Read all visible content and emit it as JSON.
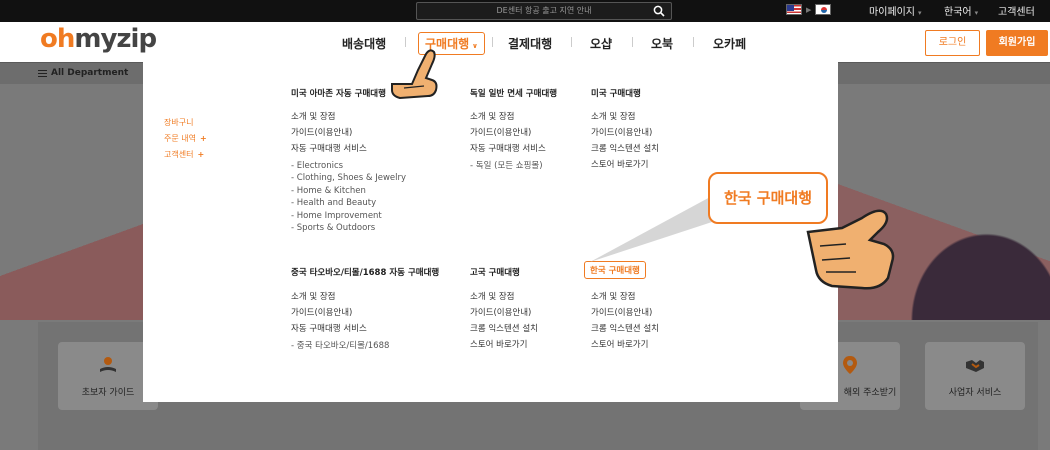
{
  "topbar": {
    "notice": "DE센터 항공 출고 지연 안내",
    "mypage": "마이페이지",
    "language": "한국어",
    "support": "고객센터"
  },
  "header": {
    "logo_oh": "oh",
    "logo_rest": "myzip",
    "nav": [
      "배송대행",
      "구매대행",
      "결제대행",
      "오샵",
      "오북",
      "오카페"
    ],
    "active_nav": "구매대행",
    "login": "로그인",
    "join": "회원가입"
  },
  "subbar": {
    "all_department": "All Department"
  },
  "dropdown": {
    "side": [
      "장바구니",
      "주문 내역",
      "고객센터"
    ],
    "amazon": {
      "title": "미국 아마존 자동 구매대행",
      "links": [
        "소개 및 장점",
        "가이드(이용안내)",
        "자동 구매대행 서비스"
      ],
      "categories": [
        "Electronics",
        "Clothing, Shoes & Jewelry",
        "Home & Kitchen",
        "Health and Beauty",
        "Home Improvement",
        "Sports & Outdoors"
      ]
    },
    "germany": {
      "title": "독일 일반 면세 구매대행",
      "links": [
        "소개 및 장점",
        "가이드(이용안내)",
        "자동 구매대행 서비스"
      ],
      "categories": [
        "독일 (모든 쇼핑몰)"
      ]
    },
    "usa": {
      "title": "미국 구매대행",
      "links": [
        "소개 및 장점",
        "가이드(이용안내)",
        "크롬 익스텐션 설치",
        "스토어 바로가기"
      ]
    },
    "china": {
      "title": "중국 타오바오/티몰/1688 자동 구매대행",
      "links": [
        "소개 및 장점",
        "가이드(이용안내)",
        "자동 구매대행 서비스"
      ],
      "categories": [
        "중국 타오바오/티몰/1688"
      ]
    },
    "other": {
      "title": "고국 구매대행",
      "links": [
        "소개 및 장점",
        "가이드(이용안내)",
        "크롬 익스텐션 설치",
        "스토어 바로가기"
      ]
    },
    "korea": {
      "title": "한국 구매대행",
      "links": [
        "소개 및 장점",
        "가이드(이용안내)",
        "크롬 익스텐션 설치",
        "스토어 바로가기"
      ]
    }
  },
  "callout": {
    "text": "한국 구매대행"
  },
  "services": [
    "초보자 가이드",
    "해외 주소받기",
    "사업자 서비스"
  ],
  "colors": {
    "accent": "#f07b22",
    "topbar": "#111111",
    "overlay": "#7a7a7a"
  }
}
